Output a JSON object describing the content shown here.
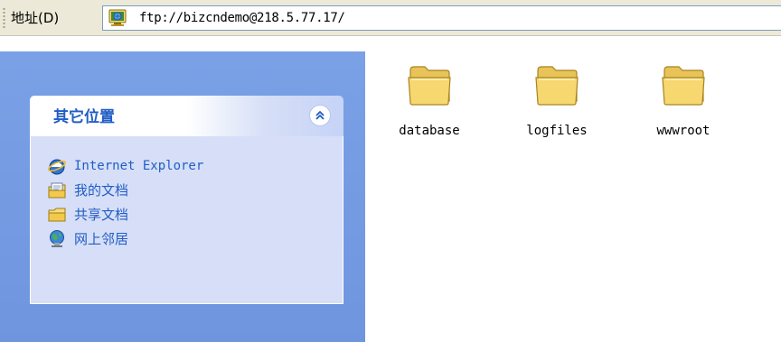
{
  "address_bar": {
    "label": "地址(D)",
    "url": "ftp://bizcndemo@218.5.77.17/"
  },
  "task_pane": {
    "title": "其它位置",
    "items": [
      {
        "label": "Internet Explorer",
        "icon": "internet-explorer-icon"
      },
      {
        "label": "我的文档",
        "icon": "my-documents-icon"
      },
      {
        "label": "共享文档",
        "icon": "shared-folder-icon"
      },
      {
        "label": "网上邻居",
        "icon": "network-places-icon"
      }
    ]
  },
  "folders": [
    {
      "name": "database"
    },
    {
      "name": "logfiles"
    },
    {
      "name": "wwwroot"
    }
  ],
  "colors": {
    "pane_blue": "#7aa1e6",
    "link_blue": "#215dc6",
    "panel_body": "#d6dff7",
    "folder_yellow": "#f2d067"
  }
}
